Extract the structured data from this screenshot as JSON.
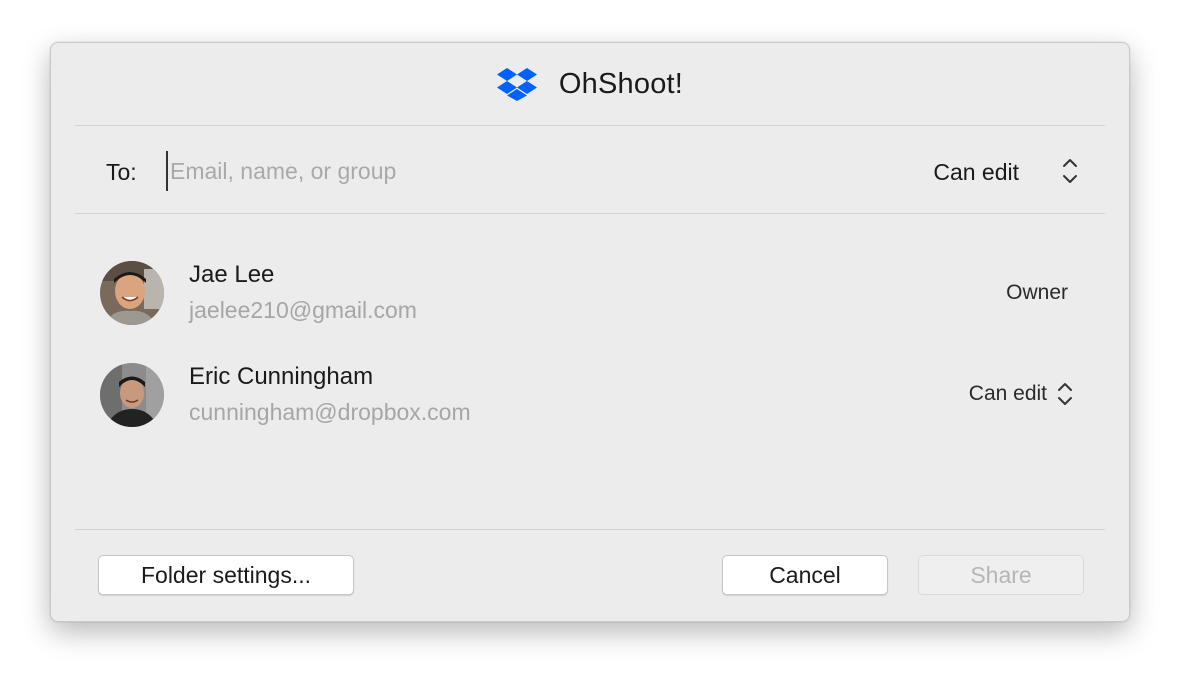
{
  "dialog": {
    "title": "OhShoot!",
    "logo_icon": "dropbox-icon",
    "brand_color": "#0061fe"
  },
  "to_row": {
    "label": "To:",
    "placeholder": "Email, name, or group",
    "value": "",
    "permission": "Can edit",
    "permission_icon": "updown-chevron-icon"
  },
  "members": [
    {
      "name": "Jae Lee",
      "email": "jaelee210@gmail.com",
      "role": "Owner"
    },
    {
      "name": "Eric Cunningham",
      "email": "cunningham@dropbox.com",
      "role": "Can edit",
      "role_icon": "updown-chevron-icon"
    }
  ],
  "footer": {
    "folder_settings_label": "Folder settings...",
    "cancel_label": "Cancel",
    "share_label": "Share"
  }
}
